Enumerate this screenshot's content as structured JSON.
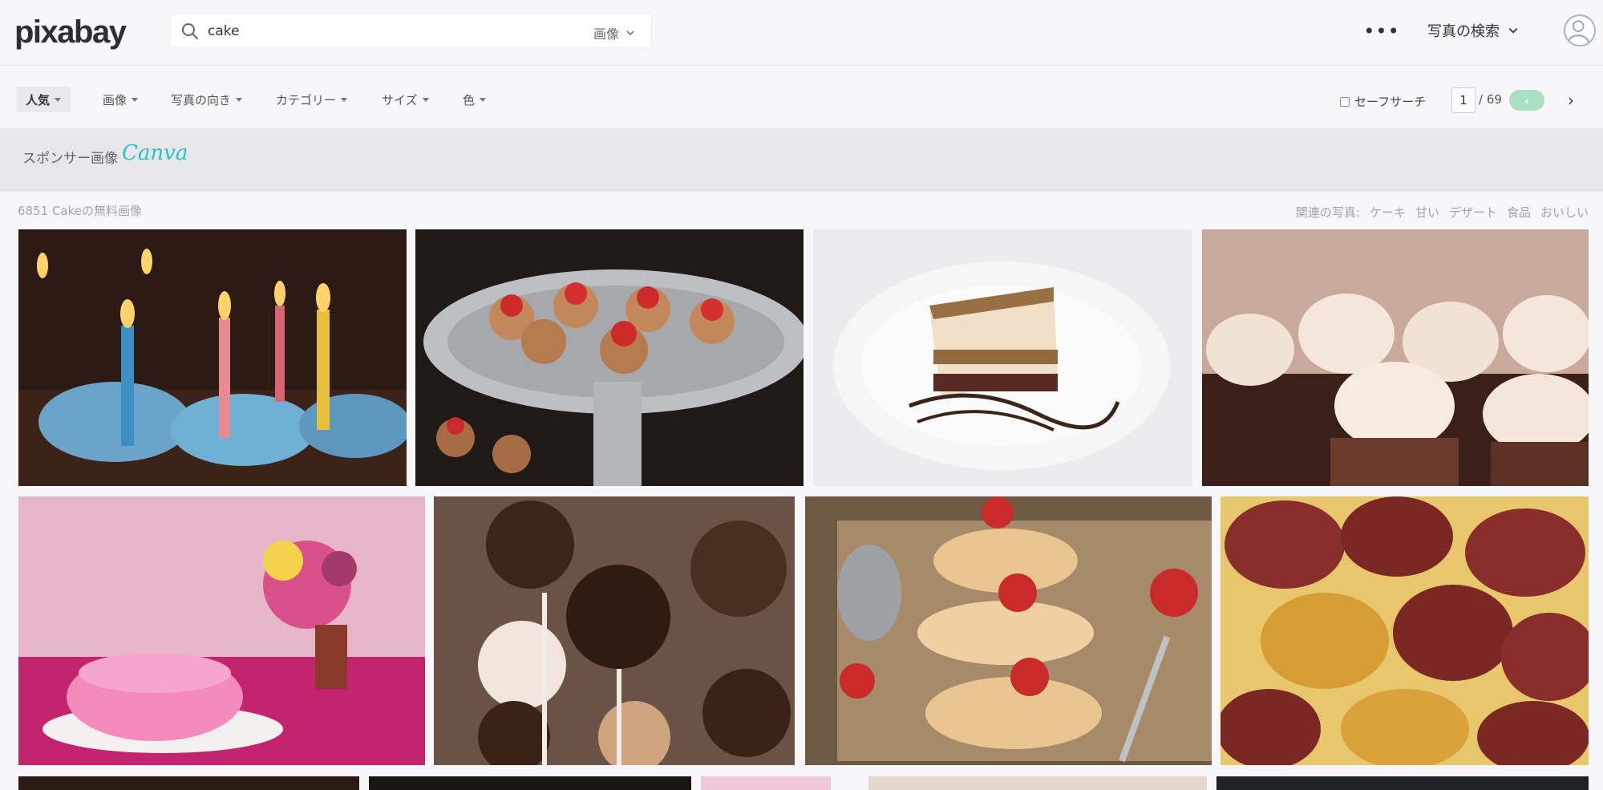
{
  "header": {
    "logo": "pixabay",
    "search": {
      "value": "cake",
      "type_label": "画像"
    },
    "more_label": "•••",
    "photo_search_label": "写真の検索"
  },
  "filters": {
    "items": [
      {
        "label": "人気",
        "active": true
      },
      {
        "label": "画像"
      },
      {
        "label": "写真の向き"
      },
      {
        "label": "カテゴリー"
      },
      {
        "label": "サイズ"
      },
      {
        "label": "色"
      }
    ],
    "safesearch_label": "セーフサーチ",
    "page_current": "1",
    "page_total": "/ 69",
    "prev_glyph": "‹",
    "next_glyph": "›"
  },
  "sponsor": {
    "label": "スポンサー画像",
    "brand": "Canva"
  },
  "results": {
    "count_label": "6851 Cakeの無料画像",
    "related_label": "関連の写真:",
    "related_tags": [
      "ケーキ",
      "甘い",
      "デザート",
      "食品",
      "おいしい"
    ]
  },
  "colors": {
    "accent_green": "#a9e0c4",
    "canva": "#20c4cb",
    "page_bg": "#f7f7fa",
    "sponsor_bg": "#e6e6eb"
  },
  "icons": {
    "search": "search-icon",
    "chevron": "chevron-down-icon",
    "avatar": "user-avatar-icon",
    "more": "more-dots-icon"
  }
}
